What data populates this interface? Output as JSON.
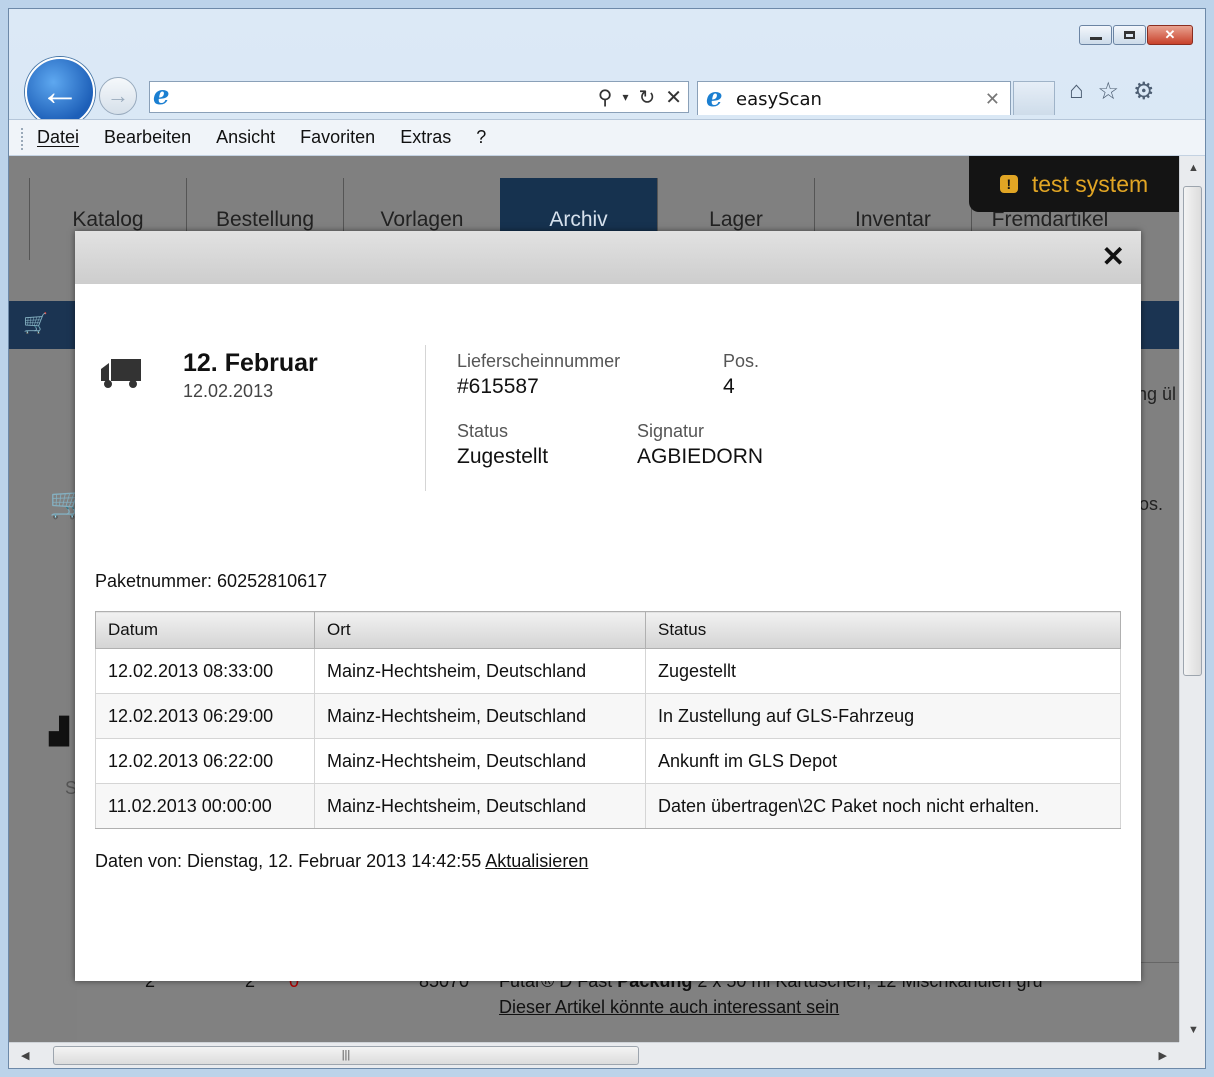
{
  "browser": {
    "tab_title": "easyScan",
    "menu": [
      "Datei",
      "Bearbeiten",
      "Ansicht",
      "Favoriten",
      "Extras",
      "?"
    ]
  },
  "app": {
    "nav_tabs": [
      "Katalog",
      "Bestellung",
      "Vorlagen",
      "Archiv",
      "Lager",
      "Inventar",
      "Fremdartikel"
    ],
    "active_tab": "Archiv",
    "system_badge": "test system",
    "bg_fragments": {
      "right1": "ng ül",
      "right2": "os.",
      "left_s": "S"
    },
    "bg_row": {
      "qty1": "2",
      "qty2": "2",
      "qty3": "0",
      "article": "85070",
      "desc_pre": "Futar® D Fast ",
      "desc_bold": "Packung",
      "desc_post": " 2 x 50 ml Kartuschen, 12 Mischkanülen grü",
      "link": "Dieser Artikel könnte auch interessant sein"
    }
  },
  "modal": {
    "date_title": "12. Februar",
    "date_sub": "12.02.2013",
    "lieferschein_label": "Lieferscheinnummer",
    "lieferschein_value": "#615587",
    "pos_label": "Pos.",
    "pos_value": "4",
    "status_label": "Status",
    "status_value": "Zugestellt",
    "signatur_label": "Signatur",
    "signatur_value": "AGBIEDORN",
    "paket_label": "Paketnummer: 60252810617",
    "table": {
      "headers": [
        "Datum",
        "Ort",
        "Status"
      ],
      "rows": [
        [
          "12.02.2013 08:33:00",
          "Mainz-Hechtsheim, Deutschland",
          "Zugestellt"
        ],
        [
          "12.02.2013 06:29:00",
          "Mainz-Hechtsheim, Deutschland",
          "In Zustellung auf GLS-Fahrzeug"
        ],
        [
          "12.02.2013 06:22:00",
          "Mainz-Hechtsheim, Deutschland",
          "Ankunft im GLS Depot"
        ],
        [
          "11.02.2013 00:00:00",
          "Mainz-Hechtsheim, Deutschland",
          "Daten übertragen\\2C Paket noch nicht erhalten."
        ]
      ]
    },
    "footer_text": "Daten von: Dienstag, 12. Februar 2013 14:42:55 ",
    "footer_link": "Aktualisieren",
    "close_glyph": "✕"
  },
  "icons": [
    "back-arrow-icon",
    "forward-arrow-icon",
    "ie-logo-icon",
    "search-icon",
    "refresh-icon",
    "stop-icon",
    "home-icon",
    "favorites-star-icon",
    "gear-icon",
    "truck-icon",
    "warning-icon",
    "cart-icon"
  ],
  "colors": {
    "active_tab": "#16324f",
    "badge_text": "#e1a524",
    "overlay": "#808080"
  }
}
